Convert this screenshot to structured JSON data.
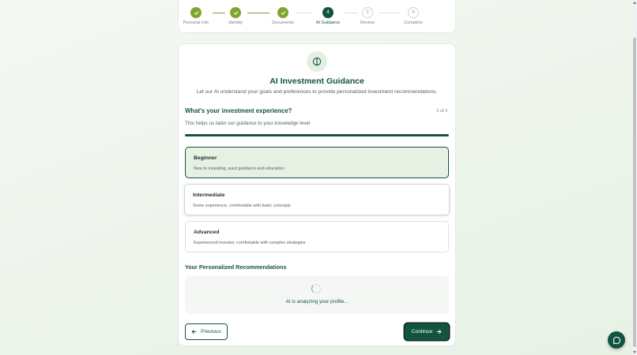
{
  "stepper": {
    "steps": [
      {
        "label": "Personal Info",
        "status": "done",
        "number": "1"
      },
      {
        "label": "Identity",
        "status": "done",
        "number": "2"
      },
      {
        "label": "Documents",
        "status": "done",
        "number": "3"
      },
      {
        "label": "AI Guidance",
        "status": "current",
        "number": "4"
      },
      {
        "label": "Review",
        "status": "todo",
        "number": "5"
      },
      {
        "label": "Complete",
        "status": "todo",
        "number": "6"
      }
    ]
  },
  "header": {
    "title": "AI Investment Guidance",
    "subtitle": "Let our AI understand your goals and preferences to provide personalized investment recommendations."
  },
  "question": {
    "text": "What's your investment experience?",
    "counter": "3 of 3",
    "hint": "This helps us tailor our guidance to your knowledge level",
    "progress": 1.0
  },
  "options": [
    {
      "title": "Beginner",
      "desc": "New to investing, want guidance and education",
      "selected": true
    },
    {
      "title": "Intermediate",
      "desc": "Some experience, comfortable with basic concepts",
      "selected": false
    },
    {
      "title": "Advanced",
      "desc": "Experienced investor, comfortable with complex strategies",
      "selected": false
    }
  ],
  "recommendations": {
    "heading": "Your Personalized Recommendations",
    "status": "AI is analyzing your profile..."
  },
  "nav": {
    "previous_label": "Previous",
    "continue_label": "Continue"
  },
  "colors": {
    "brand": "#12543f",
    "done": "#7ea62f",
    "selected_bg": "#e6f1e4"
  },
  "icons": {
    "brand": "leaf-circle-icon",
    "done": "check-icon",
    "prev": "arrow-left-icon",
    "next": "arrow-right-icon",
    "chat": "chat-bubble-icon"
  }
}
